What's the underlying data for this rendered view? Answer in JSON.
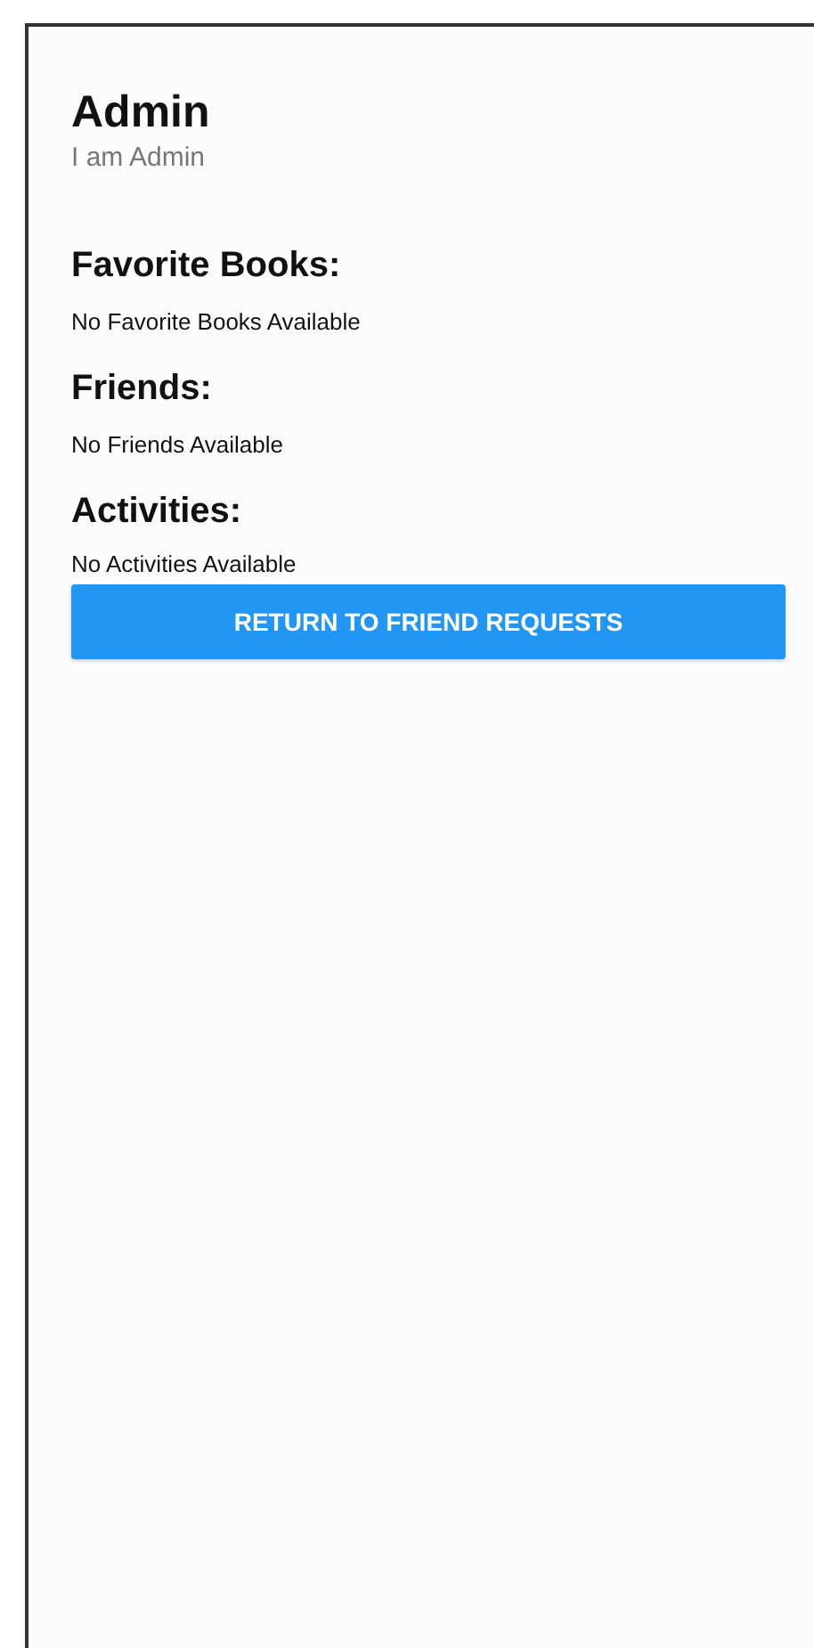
{
  "profile": {
    "name": "Admin",
    "bio": "I am Admin"
  },
  "sections": [
    {
      "heading": "Favorite Books:",
      "empty_text": "No Favorite Books Available"
    },
    {
      "heading": "Friends:",
      "empty_text": "No Friends Available"
    },
    {
      "heading": "Activities:",
      "empty_text": "No Activities Available"
    }
  ],
  "button": {
    "label": "RETURN TO FRIEND REQUESTS"
  }
}
